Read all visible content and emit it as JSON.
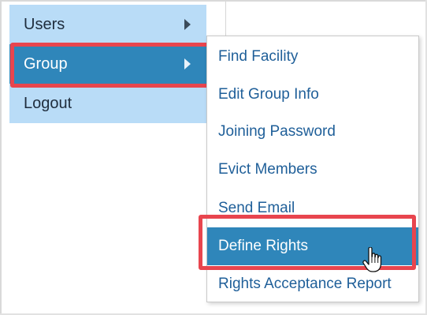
{
  "main_menu": {
    "items": [
      {
        "label": "Users",
        "has_submenu": true
      },
      {
        "label": "Group",
        "has_submenu": true,
        "active": true
      },
      {
        "label": "Logout",
        "has_submenu": false
      }
    ]
  },
  "submenu": {
    "items": [
      {
        "label": "Find Facility"
      },
      {
        "label": "Edit Group Info"
      },
      {
        "label": "Joining Password"
      },
      {
        "label": "Evict Members"
      },
      {
        "label": "Send Email"
      },
      {
        "label": "Define Rights",
        "active": true
      },
      {
        "label": "Rights Acceptance Report"
      }
    ]
  },
  "colors": {
    "menu_bg": "#b9dcf7",
    "active_bg": "#2f86ba",
    "link_text": "#1f5f99",
    "highlight_border": "#e8454e"
  },
  "icons": {
    "chevron": "chevron-right-icon",
    "cursor": "hand-pointer-icon"
  }
}
